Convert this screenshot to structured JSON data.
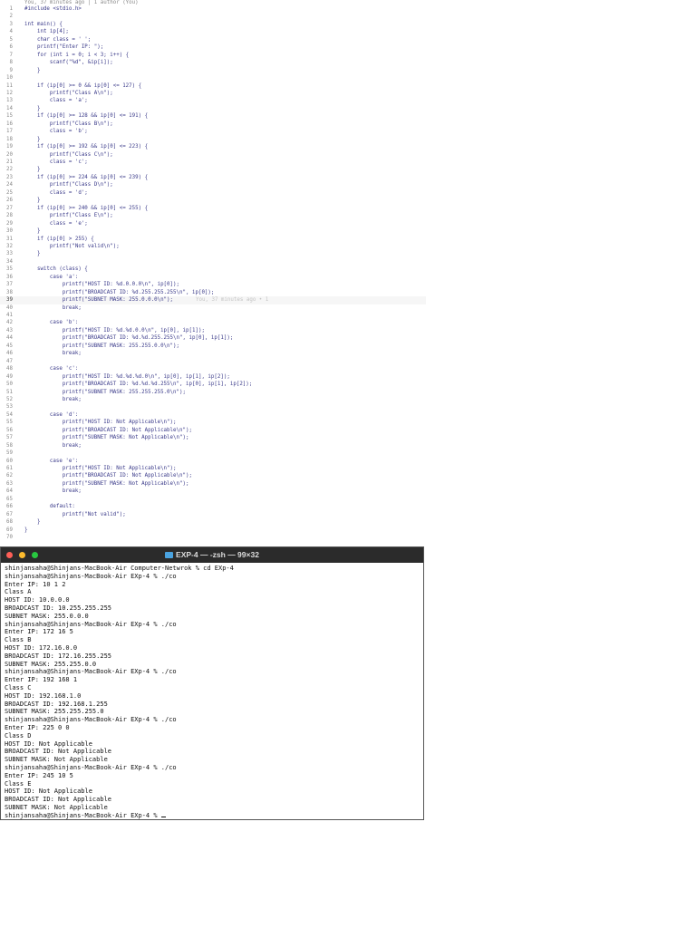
{
  "editor": {
    "codelens": "You, 37 minutes ago | 1 author (You)",
    "current_line": 39,
    "blame": "You, 37 minutes ago • 1",
    "lines": [
      "#include <stdio.h>",
      "",
      "int main() {",
      "    int ip[4];",
      "    char class = ' ';",
      "    printf(\"Enter IP: \");",
      "    for (int i = 0; i < 3; i++) {",
      "        scanf(\"%d\", &ip[i]);",
      "    }",
      "",
      "    if (ip[0] >= 0 && ip[0] <= 127) {",
      "        printf(\"Class A\\n\");",
      "        class = 'a';",
      "    }",
      "    if (ip[0] >= 128 && ip[0] <= 191) {",
      "        printf(\"Class B\\n\");",
      "        class = 'b';",
      "    }",
      "    if (ip[0] >= 192 && ip[0] <= 223) {",
      "        printf(\"Class C\\n\");",
      "        class = 'c';",
      "    }",
      "    if (ip[0] >= 224 && ip[0] <= 239) {",
      "        printf(\"Class D\\n\");",
      "        class = 'd';",
      "    }",
      "    if (ip[0] >= 240 && ip[0] <= 255) {",
      "        printf(\"Class E\\n\");",
      "        class = 'e';",
      "    }",
      "    if (ip[0] > 255) {",
      "        printf(\"Not valid\\n\");",
      "    }",
      "",
      "    switch (class) {",
      "        case 'a':",
      "            printf(\"HOST ID: %d.0.0.0\\n\", ip[0]);",
      "            printf(\"BROADCAST ID: %d.255.255.255\\n\", ip[0]);",
      "            printf(\"SUBNET MASK: 255.0.0.0\\n\");",
      "            break;",
      "",
      "        case 'b':",
      "            printf(\"HOST ID: %d.%d.0.0\\n\", ip[0], ip[1]);",
      "            printf(\"BROADCAST ID: %d.%d.255.255\\n\", ip[0], ip[1]);",
      "            printf(\"SUBNET MASK: 255.255.0.0\\n\");",
      "            break;",
      "",
      "        case 'c':",
      "            printf(\"HOST ID: %d.%d.%d.0\\n\", ip[0], ip[1], ip[2]);",
      "            printf(\"BROADCAST ID: %d.%d.%d.255\\n\", ip[0], ip[1], ip[2]);",
      "            printf(\"SUBNET MASK: 255.255.255.0\\n\");",
      "            break;",
      "",
      "        case 'd':",
      "            printf(\"HOST ID: Not Applicable\\n\");",
      "            printf(\"BROADCAST ID: Not Applicable\\n\");",
      "            printf(\"SUBNET MASK: Not Applicable\\n\");",
      "            break;",
      "",
      "        case 'e':",
      "            printf(\"HOST ID: Not Applicable\\n\");",
      "            printf(\"BROADCAST ID: Not Applicable\\n\");",
      "            printf(\"SUBNET MASK: Not Applicable\\n\");",
      "            break;",
      "",
      "        default:",
      "            printf(\"Not valid\");",
      "    }",
      "}",
      ""
    ]
  },
  "terminal": {
    "title": "EXP-4 — -zsh — 99×32",
    "colors": {
      "close": "#fe5f57",
      "minimize": "#febc2e",
      "zoom": "#28c840"
    },
    "lines": [
      "shinjansaha@Shinjans-MacBook-Air Computer-Netwrok % cd EXp-4",
      "shinjansaha@Shinjans-MacBook-Air EXp-4 % ./co",
      "Enter IP: 10 1 2",
      "Class A",
      "HOST ID: 10.0.0.0",
      "BROADCAST ID: 10.255.255.255",
      "SUBNET MASK: 255.0.0.0",
      "shinjansaha@Shinjans-MacBook-Air EXp-4 % ./co",
      "Enter IP: 172 16 5",
      "Class B",
      "HOST ID: 172.16.0.0",
      "BROADCAST ID: 172.16.255.255",
      "SUBNET MASK: 255.255.0.0",
      "shinjansaha@Shinjans-MacBook-Air EXp-4 % ./co",
      "Enter IP: 192 168 1",
      "Class C",
      "HOST ID: 192.168.1.0",
      "BROADCAST ID: 192.168.1.255",
      "SUBNET MASK: 255.255.255.0",
      "shinjansaha@Shinjans-MacBook-Air EXp-4 % ./co",
      "Enter IP: 225 0 0",
      "Class D",
      "HOST ID: Not Applicable",
      "BROADCAST ID: Not Applicable",
      "SUBNET MASK: Not Applicable",
      "shinjansaha@Shinjans-MacBook-Air EXp-4 % ./co",
      "Enter IP: 245 10 5",
      "Class E",
      "HOST ID: Not Applicable",
      "BROADCAST ID: Not Applicable",
      "SUBNET MASK: Not Applicable",
      "shinjansaha@Shinjans-MacBook-Air EXp-4 % "
    ]
  }
}
